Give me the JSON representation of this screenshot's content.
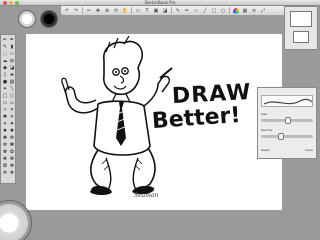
{
  "window": {
    "title": "SketchBook Pro"
  },
  "canvas": {
    "art_text_line1": "DRAW",
    "art_text_line2": "Better!",
    "signature": "Seaman"
  },
  "panels": {
    "brush_properties": {
      "size_label": "Size",
      "opacity_label": "Opacity",
      "reset_label": "Reset",
      "close_label": "Close",
      "size_value": 0.5,
      "opacity_value": 0.35
    }
  },
  "colors": {
    "background": "#9a9a9a",
    "canvas": "#ffffff",
    "ink": "#111111",
    "accent_red": "#c0392b",
    "accent_blue": "#2f6fd3"
  },
  "icons": {
    "toolbar": [
      "undo-icon",
      "redo-icon",
      "cut-icon",
      "move-icon",
      "zoom-icon",
      "rotate-icon",
      "pan-icon",
      "select-icon",
      "text-icon",
      "image-icon",
      "fill-icon",
      "brush-icon",
      "pencil-icon",
      "eraser-icon",
      "line-icon",
      "rect-icon",
      "ellipse-icon",
      "color-icon",
      "grid-icon",
      "layers-icon",
      "full-screen-icon"
    ]
  }
}
